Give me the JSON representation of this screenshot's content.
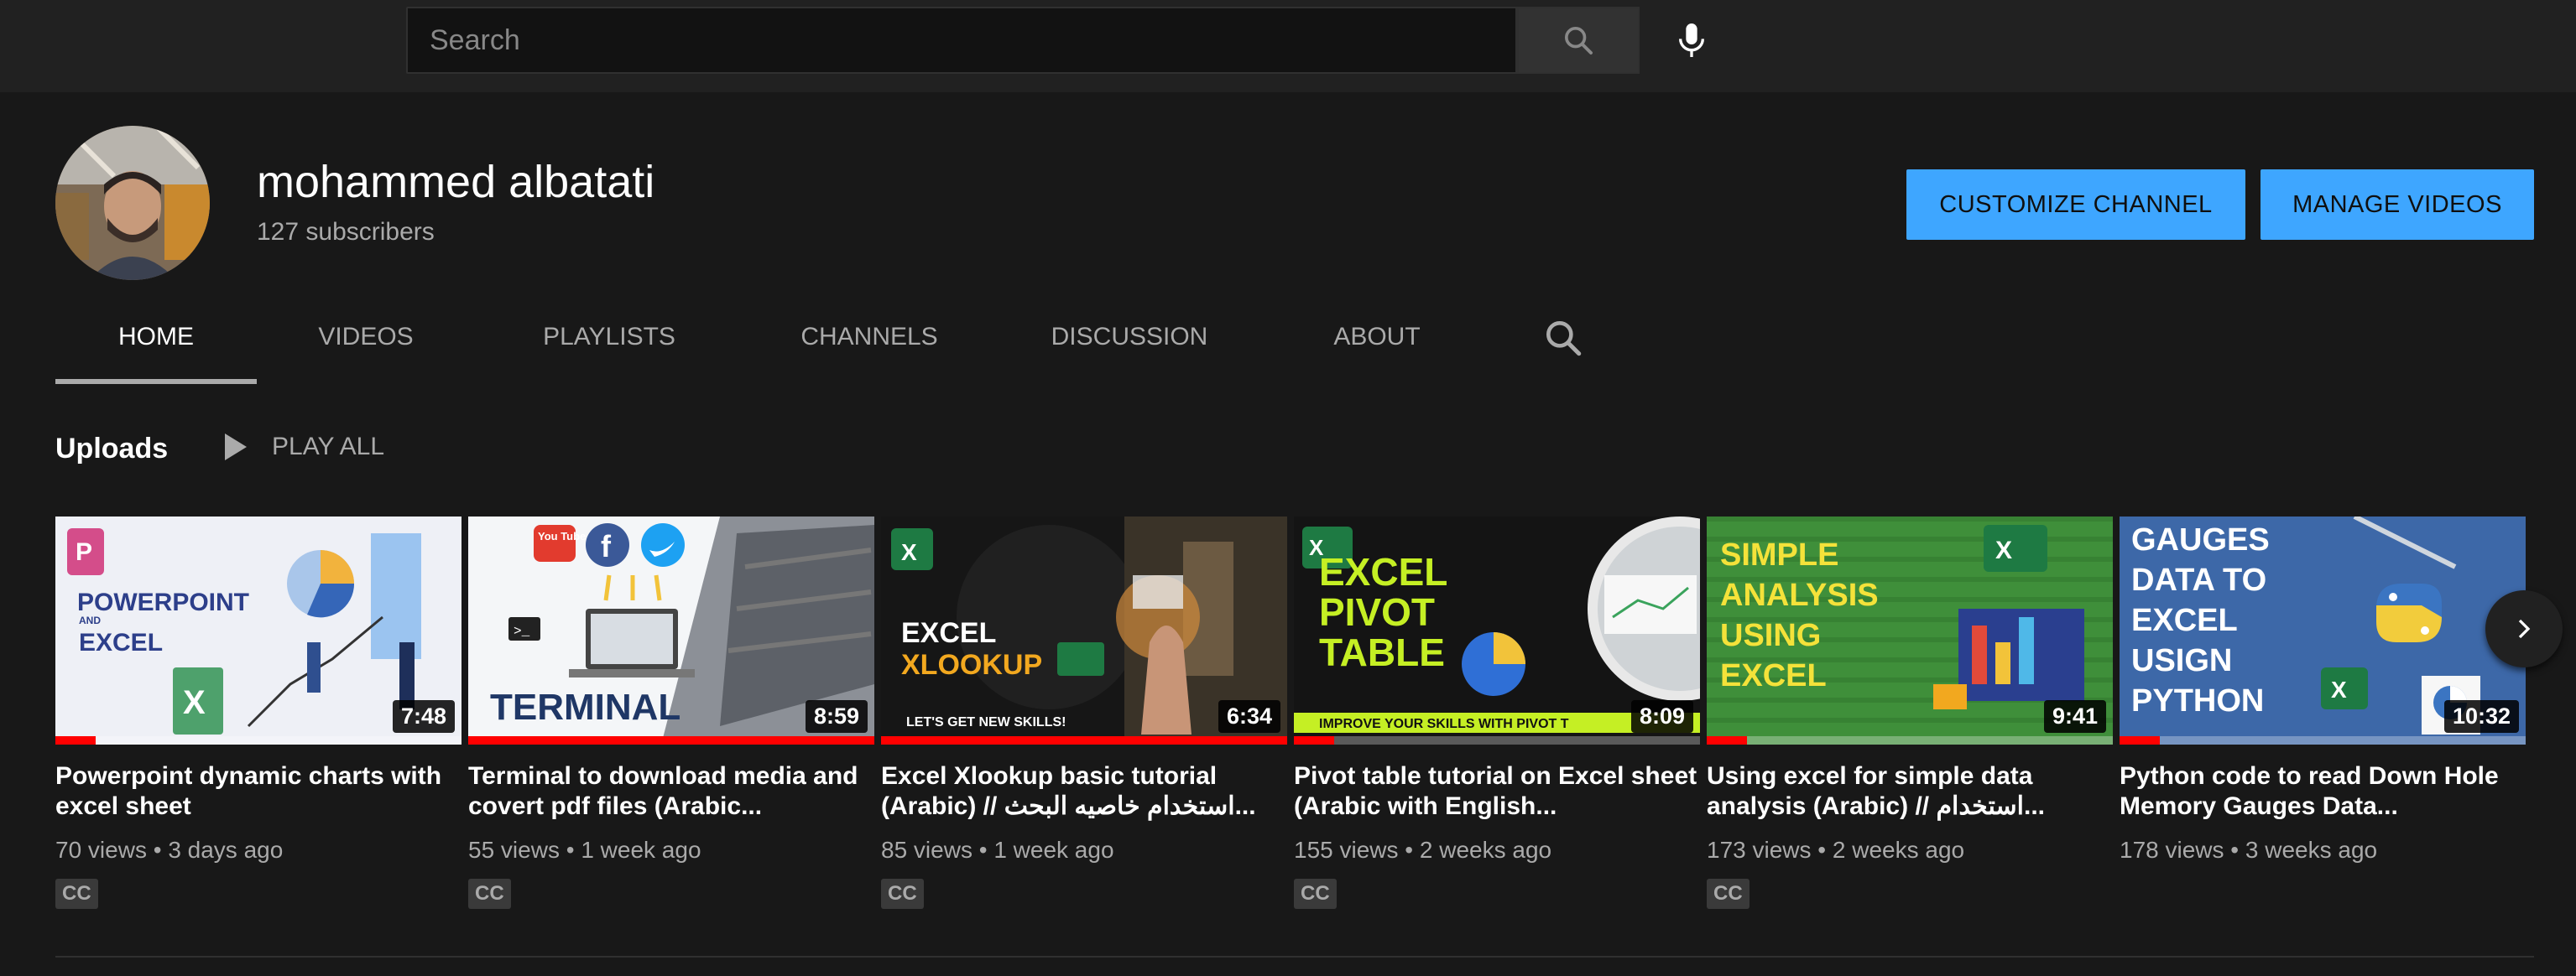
{
  "search": {
    "placeholder": "Search"
  },
  "channel": {
    "name": "mohammed albatati",
    "subscribers": "127 subscribers",
    "customize_label": "CUSTOMIZE CHANNEL",
    "manage_label": "MANAGE VIDEOS"
  },
  "tabs": [
    {
      "label": "HOME",
      "active": true
    },
    {
      "label": "VIDEOS"
    },
    {
      "label": "PLAYLISTS"
    },
    {
      "label": "CHANNELS"
    },
    {
      "label": "DISCUSSION"
    },
    {
      "label": "ABOUT"
    }
  ],
  "uploads": {
    "title": "Uploads",
    "play_all": "PLAY ALL",
    "videos": [
      {
        "title": "Powerpoint dynamic charts with excel sheet",
        "views": "70 views",
        "age": "3 days ago",
        "duration": "7:48",
        "cc": "CC",
        "progress": 0.1,
        "thumb_text": [
          "POWERPOINT",
          "AND",
          "EXCEL"
        ]
      },
      {
        "title": "Terminal to download media and covert pdf files (Arabic...",
        "views": "55 views",
        "age": "1 week ago",
        "duration": "8:59",
        "cc": "CC",
        "progress": 1.0,
        "thumb_text": [
          "TERMINAL",
          "You Tube"
        ]
      },
      {
        "title": "Excel Xlookup basic tutorial (Arabic) // استخدام خاصيه البحث...",
        "views": "85 views",
        "age": "1 week ago",
        "duration": "6:34",
        "cc": "CC",
        "progress": 1.0,
        "thumb_text": [
          "EXCEL",
          "XLOOKUP",
          "LET'S GET NEW SKILLS!"
        ]
      },
      {
        "title": "Pivot table tutorial on Excel sheet (Arabic with English...",
        "views": "155 views",
        "age": "2 weeks ago",
        "duration": "8:09",
        "cc": "CC",
        "progress": 0.1,
        "thumb_text": [
          "EXCEL",
          "PIVOT",
          "TABLE",
          "IMPROVE YOUR SKILLS WITH PIVOT T"
        ]
      },
      {
        "title": "Using excel for simple data analysis (Arabic) // استخدام...",
        "views": "173 views",
        "age": "2 weeks ago",
        "duration": "9:41",
        "cc": "CC",
        "progress": 0.1,
        "thumb_text": [
          "SIMPLE",
          "ANALYSIS",
          "USING",
          "EXCEL"
        ]
      },
      {
        "title": "Python code to read Down Hole Memory Gauges Data...",
        "views": "178 views",
        "age": "3 weeks ago",
        "duration": "10:32",
        "cc": "",
        "progress": 0.1,
        "thumb_text": [
          "GAUGES",
          "DATA TO",
          "EXCEL",
          "USIGN",
          "PYTHON"
        ]
      }
    ]
  },
  "colors": {
    "accent_blue": "#3ea6ff",
    "progress_red": "#ff0000",
    "background": "#181818",
    "masthead": "#212121"
  },
  "icons": {
    "search": "search-icon",
    "mic": "microphone-icon",
    "next": "chevron-right-icon",
    "play": "play-icon"
  }
}
